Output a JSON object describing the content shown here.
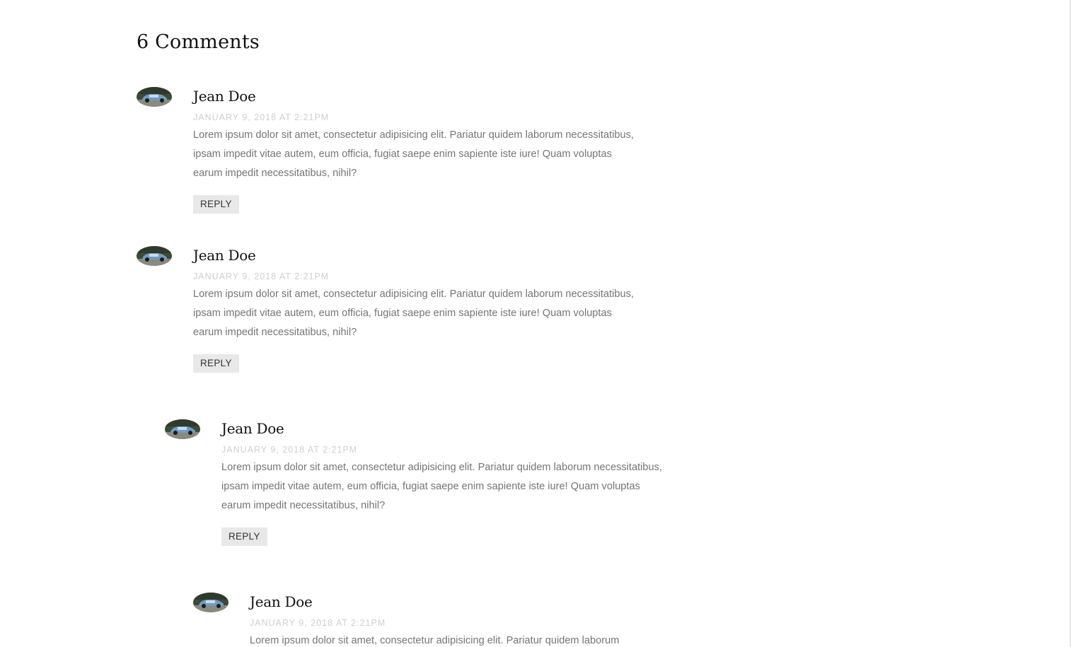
{
  "comments_section": {
    "title": "6 Comments",
    "comments": [
      {
        "author": "Jean Doe",
        "date": "January 9, 2018 at 2:21pm",
        "text": "Lorem ipsum dolor sit amet, consectetur adipisicing elit. Pariatur quidem laborum necessitatibus, ipsam impedit vitae autem, eum officia, fugiat saepe enim sapiente iste iure! Quam voluptas earum impedit necessitatibus, nihil?",
        "reply_label": "Reply"
      },
      {
        "author": "Jean Doe",
        "date": "January 9, 2018 at 2:21pm",
        "text": "Lorem ipsum dolor sit amet, consectetur adipisicing elit. Pariatur quidem laborum necessitatibus, ipsam impedit vitae autem, eum officia, fugiat saepe enim sapiente iste iure! Quam voluptas earum impedit necessitatibus, nihil?",
        "reply_label": "Reply"
      },
      {
        "author": "Jean Doe",
        "date": "January 9, 2018 at 2:21pm",
        "text": "Lorem ipsum dolor sit amet, consectetur adipisicing elit. Pariatur quidem laborum necessitatibus, ipsam impedit vitae autem, eum officia, fugiat saepe enim sapiente iste iure! Quam voluptas earum impedit necessitatibus, nihil?",
        "reply_label": "Reply"
      },
      {
        "author": "Jean Doe",
        "date": "January 9, 2018 at 2:21pm",
        "text": "Lorem ipsum dolor sit amet, consectetur adipisicing elit. Pariatur quidem laborum"
      }
    ]
  }
}
